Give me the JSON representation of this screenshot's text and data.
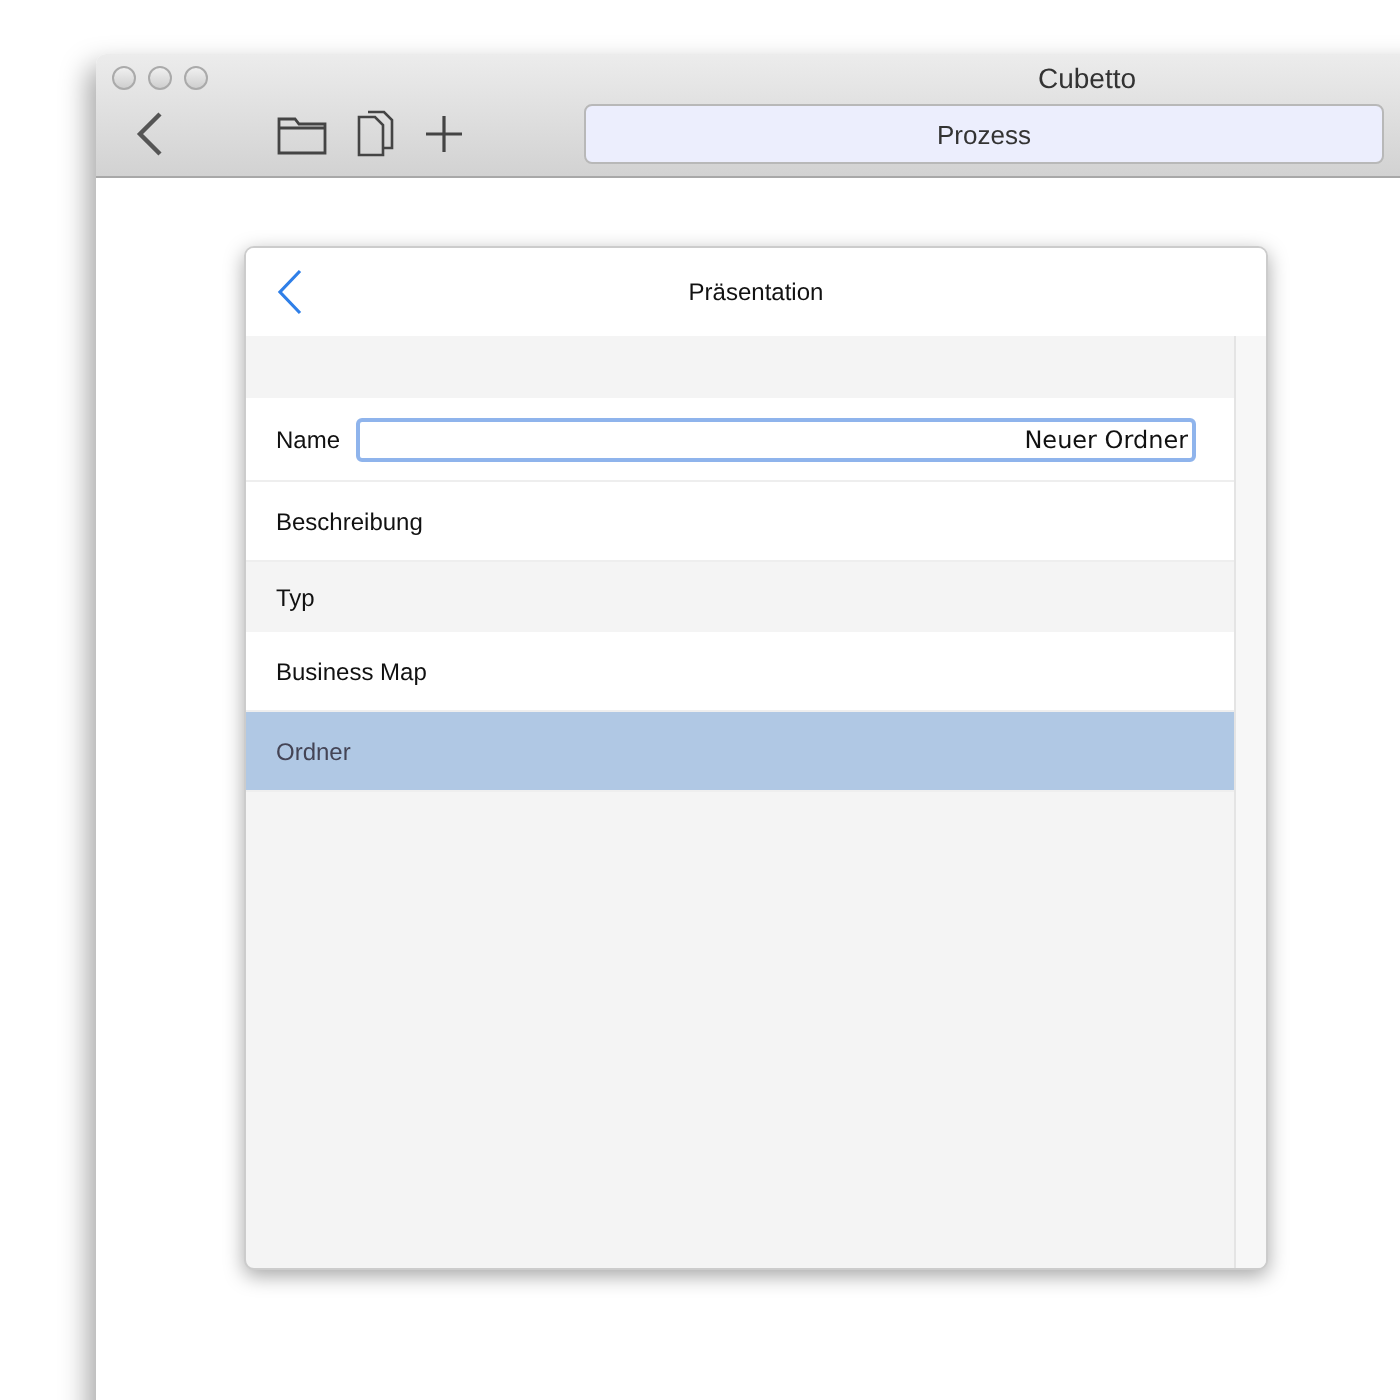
{
  "window": {
    "title": "Cubetto"
  },
  "toolbar": {
    "segment": "Prozess"
  },
  "dialog": {
    "title": "Präsentation",
    "rows": [
      {
        "kind": "field",
        "label": "Name",
        "value": "Neuer Ordner"
      },
      {
        "kind": "text",
        "label": "Beschreibung"
      },
      {
        "kind": "header",
        "label": "Typ"
      },
      {
        "kind": "option",
        "label": "Business Map",
        "selected": false
      },
      {
        "kind": "option",
        "label": "Ordner",
        "selected": true
      }
    ]
  }
}
